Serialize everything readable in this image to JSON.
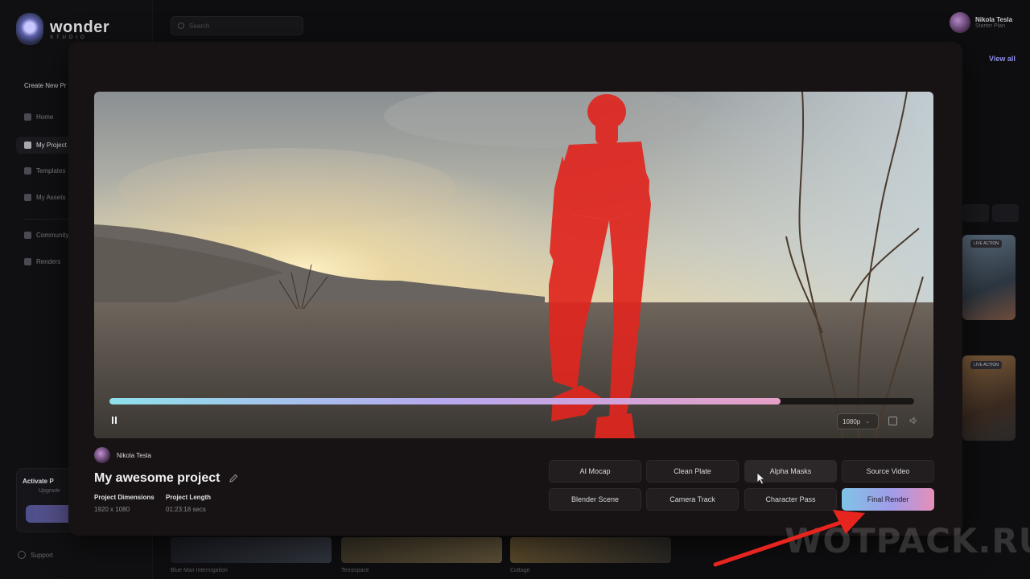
{
  "brand": {
    "name": "wonder",
    "sub": "STUDIO"
  },
  "sidebar": {
    "create_new": "Create New Pr",
    "items": [
      {
        "label": "Home",
        "icon": "home-icon"
      },
      {
        "label": "My Project",
        "icon": "folder-icon",
        "active": true
      },
      {
        "label": "Templates",
        "icon": "template-icon"
      },
      {
        "label": "My Assets",
        "icon": "assets-icon"
      },
      {
        "label": "Community",
        "icon": "community-icon"
      },
      {
        "label": "Renders",
        "icon": "renders-icon"
      }
    ],
    "activate": {
      "title": "Activate P",
      "sub": "Upgrade"
    },
    "support": "Support"
  },
  "topbar": {
    "search_placeholder": "Search",
    "user_name": "Nikola Tesla",
    "user_plan": "Starter Plan"
  },
  "background": {
    "view_all": "View all",
    "tags": [
      "LIVE ACTION",
      "LIVE ACTION"
    ],
    "captions": [
      "Blue Man Interrogation",
      "Terraspace",
      "Cottage"
    ]
  },
  "player": {
    "progress_fraction": 0.834,
    "resolution": "1080p",
    "icons": [
      "pause-icon",
      "screenshot-icon",
      "volume-icon"
    ]
  },
  "project": {
    "author": "Nikola Tesla",
    "title": "My awesome project",
    "dimensions_label": "Project Dimensions",
    "dimensions_value": "1920 x 1080",
    "length_label": "Project Length",
    "length_value": "01:23:18 secs"
  },
  "actions": {
    "row1": [
      "AI Mocap",
      "Clean Plate",
      "Alpha Masks",
      "Source Video"
    ],
    "row2": [
      "Blender Scene",
      "Camera Track",
      "Character Pass",
      "Final Render"
    ]
  },
  "watermark": "WOTPACK.RU",
  "colors": {
    "accent": "#8e90e8",
    "mask": "#e0261f",
    "arrow": "#e8241f"
  }
}
